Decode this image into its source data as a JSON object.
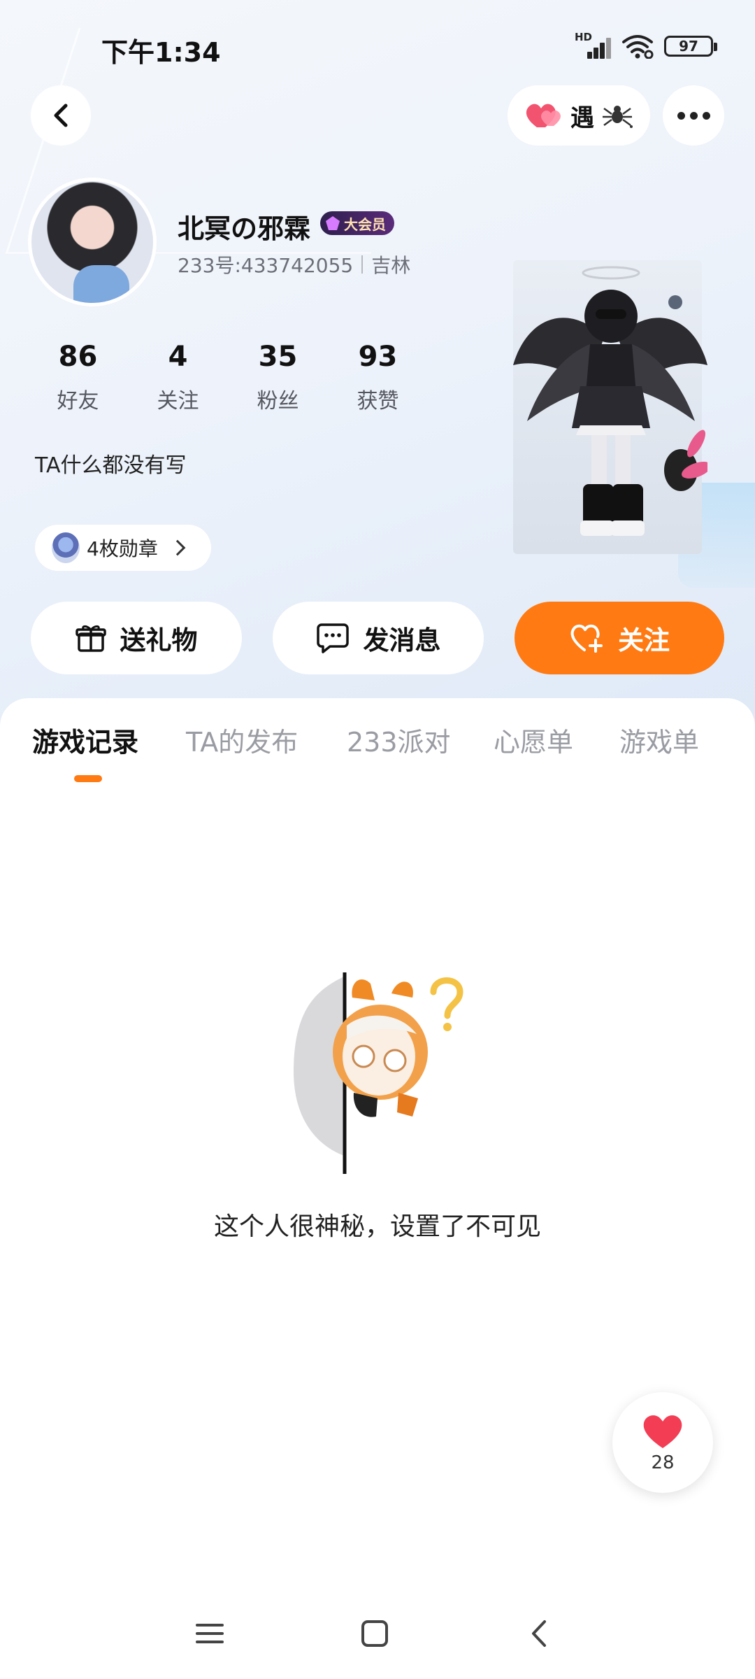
{
  "status_bar": {
    "time": "下午1:34",
    "signal_label": "HD",
    "battery": "97"
  },
  "header": {
    "encounter_label": "遇"
  },
  "profile": {
    "nickname": "北冥の邪霖",
    "vip_label": "大会员",
    "user_id": "233号:433742055",
    "location": "吉林",
    "bio": "TA什么都没有写",
    "stats": [
      {
        "value": "86",
        "label": "好友"
      },
      {
        "value": "4",
        "label": "关注"
      },
      {
        "value": "35",
        "label": "粉丝"
      },
      {
        "value": "93",
        "label": "获赞"
      }
    ],
    "medal_label": "4枚勋章"
  },
  "actions": {
    "gift_label": "送礼物",
    "message_label": "发消息",
    "follow_label": "关注"
  },
  "tabs": [
    {
      "label": "游戏记录",
      "active": true
    },
    {
      "label": "TA的发布",
      "active": false
    },
    {
      "label": "233派对",
      "active": false
    },
    {
      "label": "心愿单",
      "active": false
    },
    {
      "label": "游戏单",
      "active": false
    }
  ],
  "empty_state": {
    "message": "这个人很神秘，设置了不可见"
  },
  "like_fab": {
    "count": "28"
  },
  "colors": {
    "accent": "#ff7a12",
    "heart": "#f2536f",
    "vip_badge_bg": "#3a2660"
  },
  "icons": [
    "back-icon",
    "heart-icon",
    "spider-icon",
    "more-icon",
    "gift-icon",
    "chat-icon",
    "heart-plus-icon",
    "chevron-right-icon",
    "menu-icon",
    "home-icon",
    "back-nav-icon"
  ]
}
